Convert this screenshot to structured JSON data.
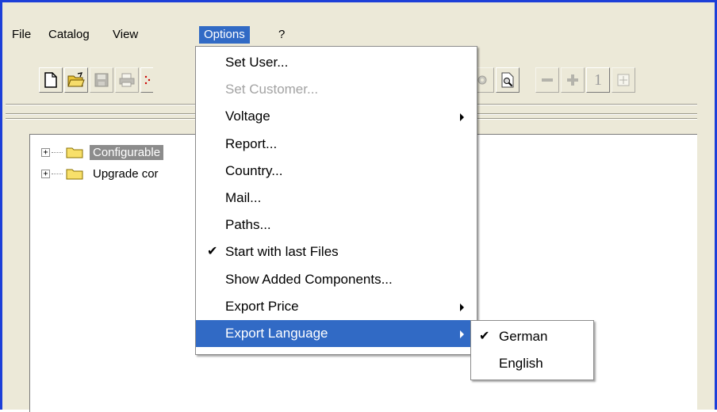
{
  "menubar": {
    "items": [
      {
        "label": "File"
      },
      {
        "label": "Catalog"
      },
      {
        "label": "View"
      },
      {
        "label": "Options"
      },
      {
        "label": "?"
      }
    ]
  },
  "toolbar": {
    "page_number": "1"
  },
  "tree": {
    "items": [
      {
        "label": "Configurable"
      },
      {
        "label": "Upgrade cor"
      }
    ]
  },
  "options_menu": {
    "items": [
      {
        "label": "Set User..."
      },
      {
        "label": "Set Customer..."
      },
      {
        "label": "Voltage"
      },
      {
        "label": "Report..."
      },
      {
        "label": "Country..."
      },
      {
        "label": "Mail..."
      },
      {
        "label": "Paths..."
      },
      {
        "label": "Start with last Files"
      },
      {
        "label": "Show Added Components..."
      },
      {
        "label": "Export Price"
      },
      {
        "label": "Export Language"
      }
    ]
  },
  "language_menu": {
    "items": [
      {
        "label": "German"
      },
      {
        "label": "English"
      }
    ]
  },
  "colors": {
    "highlight": "#316ac5",
    "window_border": "#1d3fd8",
    "chrome": "#ece9d8"
  }
}
